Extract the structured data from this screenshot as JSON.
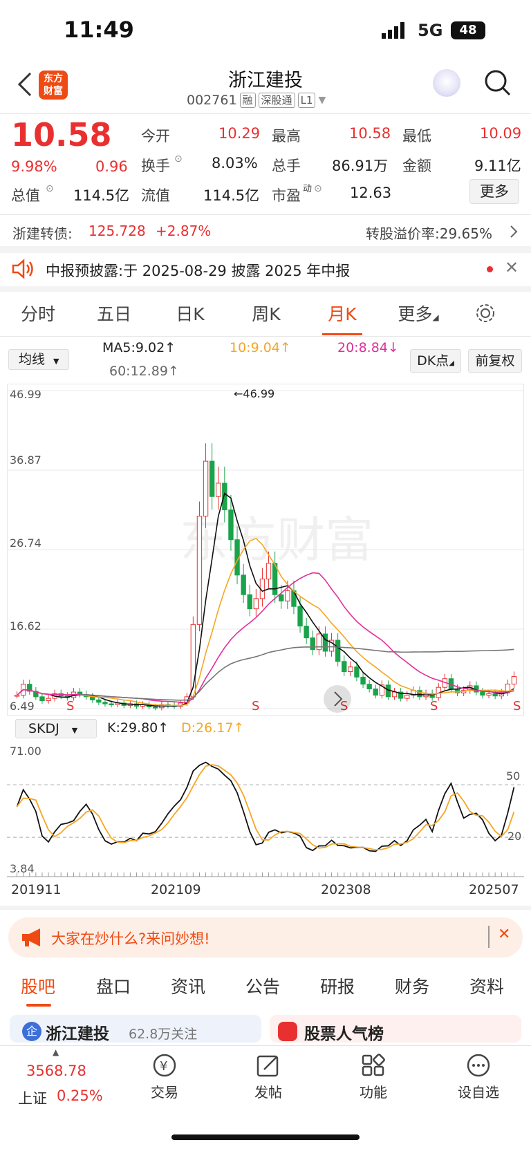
{
  "status": {
    "time": "11:49",
    "network": "5G",
    "battery": "48"
  },
  "header": {
    "title": "浙江建投",
    "code": "002761",
    "tags": [
      "融",
      "深股通",
      "L1"
    ]
  },
  "quote": {
    "price": "10.58",
    "pct": "9.98%",
    "chg": "0.96",
    "open_l": "今开",
    "open": "10.29",
    "high_l": "最高",
    "high": "10.58",
    "low_l": "最低",
    "low": "10.09",
    "turn_l": "换手",
    "turn": "8.03%",
    "vol_l": "总手",
    "vol": "86.91万",
    "amt_l": "金额",
    "amt": "9.11亿",
    "mcap_l": "总值",
    "mcap": "114.5亿",
    "float_l": "流值",
    "float": "114.5亿",
    "pe_l": "市盈",
    "pe_sup": "动",
    "pe": "12.63",
    "more": "更多"
  },
  "bond": {
    "label": "浙建转债:",
    "price": "125.728",
    "pct": "+2.87%",
    "premium": "转股溢价率:29.65%"
  },
  "notice": {
    "text": "中报预披露:于 2025-08-29 披露 2025 年中报"
  },
  "tabs": [
    "分时",
    "五日",
    "日K",
    "周K",
    "月K",
    "更多"
  ],
  "ma": {
    "select": "均线",
    "ma5": "MA5:9.02",
    "ma10": "10:9.04",
    "ma20": "20:8.84",
    "ma60": "60:12.89",
    "dk": "DK点",
    "fq": "前复权"
  },
  "kline": {
    "y_labels": [
      "46.99",
      "36.87",
      "26.74",
      "16.62",
      "6.49"
    ],
    "max_label": "46.99",
    "min_label": "6.49"
  },
  "kdj": {
    "select": "SKDJ",
    "k": "K:29.80",
    "d": "D:26.17",
    "y_top": "71.00",
    "y_bottom": "3.84",
    "l50": "50",
    "l20": "20",
    "x_labels": [
      "201911",
      "202109",
      "202308",
      "202507"
    ]
  },
  "banner": {
    "text": "大家在炒什么?来问妙想!"
  },
  "btabs": [
    "股吧",
    "盘口",
    "资讯",
    "公告",
    "研报",
    "财务",
    "资料"
  ],
  "cards": {
    "left": "浙江建投",
    "left_sub": "62.8万关注",
    "right": "股票人气榜"
  },
  "bottom": {
    "index_val": "3568.78",
    "index_name": "上证",
    "index_pct": "0.25%",
    "trade": "交易",
    "post": "发帖",
    "func": "功能",
    "fav": "设自选"
  },
  "colors": {
    "up": "#e93030",
    "down": "#1aa34a",
    "accent": "#f04a13"
  },
  "chart_data": {
    "type": "candlestick",
    "title": "浙江建投 月K",
    "y_range": [
      6.49,
      46.99
    ],
    "x_ticks": [
      "201911",
      "202109",
      "202308",
      "202507"
    ],
    "series": [
      {
        "name": "MA5",
        "last": 9.02
      },
      {
        "name": "MA10",
        "last": 9.04
      },
      {
        "name": "MA20",
        "last": 8.84
      },
      {
        "name": "MA60",
        "last": 12.89
      }
    ],
    "closes": [
      8.2,
      9.6,
      8.7,
      8.0,
      7.5,
      7.8,
      8.4,
      8.1,
      7.9,
      8.6,
      8.3,
      8.0,
      7.6,
      7.3,
      7.1,
      7.0,
      7.2,
      6.9,
      7.1,
      6.8,
      7.0,
      6.7,
      6.6,
      7.0,
      6.9,
      6.8,
      7.2,
      8.0,
      17.2,
      31.0,
      38.0,
      33.5,
      35.2,
      31.8,
      28.0,
      23.5,
      21.0,
      19.2,
      20.5,
      23.0,
      25.0,
      21.0,
      20.2,
      21.5,
      19.5,
      17.0,
      15.5,
      14.0,
      16.0,
      13.8,
      15.2,
      12.5,
      11.2,
      11.8,
      10.5,
      9.6,
      9.0,
      8.2,
      9.5,
      8.0,
      8.6,
      7.8,
      8.2,
      8.8,
      8.0,
      8.4,
      7.9,
      9.2,
      10.3,
      9.0,
      8.5,
      8.8,
      9.4,
      8.6,
      8.2,
      8.4,
      8.1,
      8.5,
      9.62,
      10.58
    ]
  }
}
